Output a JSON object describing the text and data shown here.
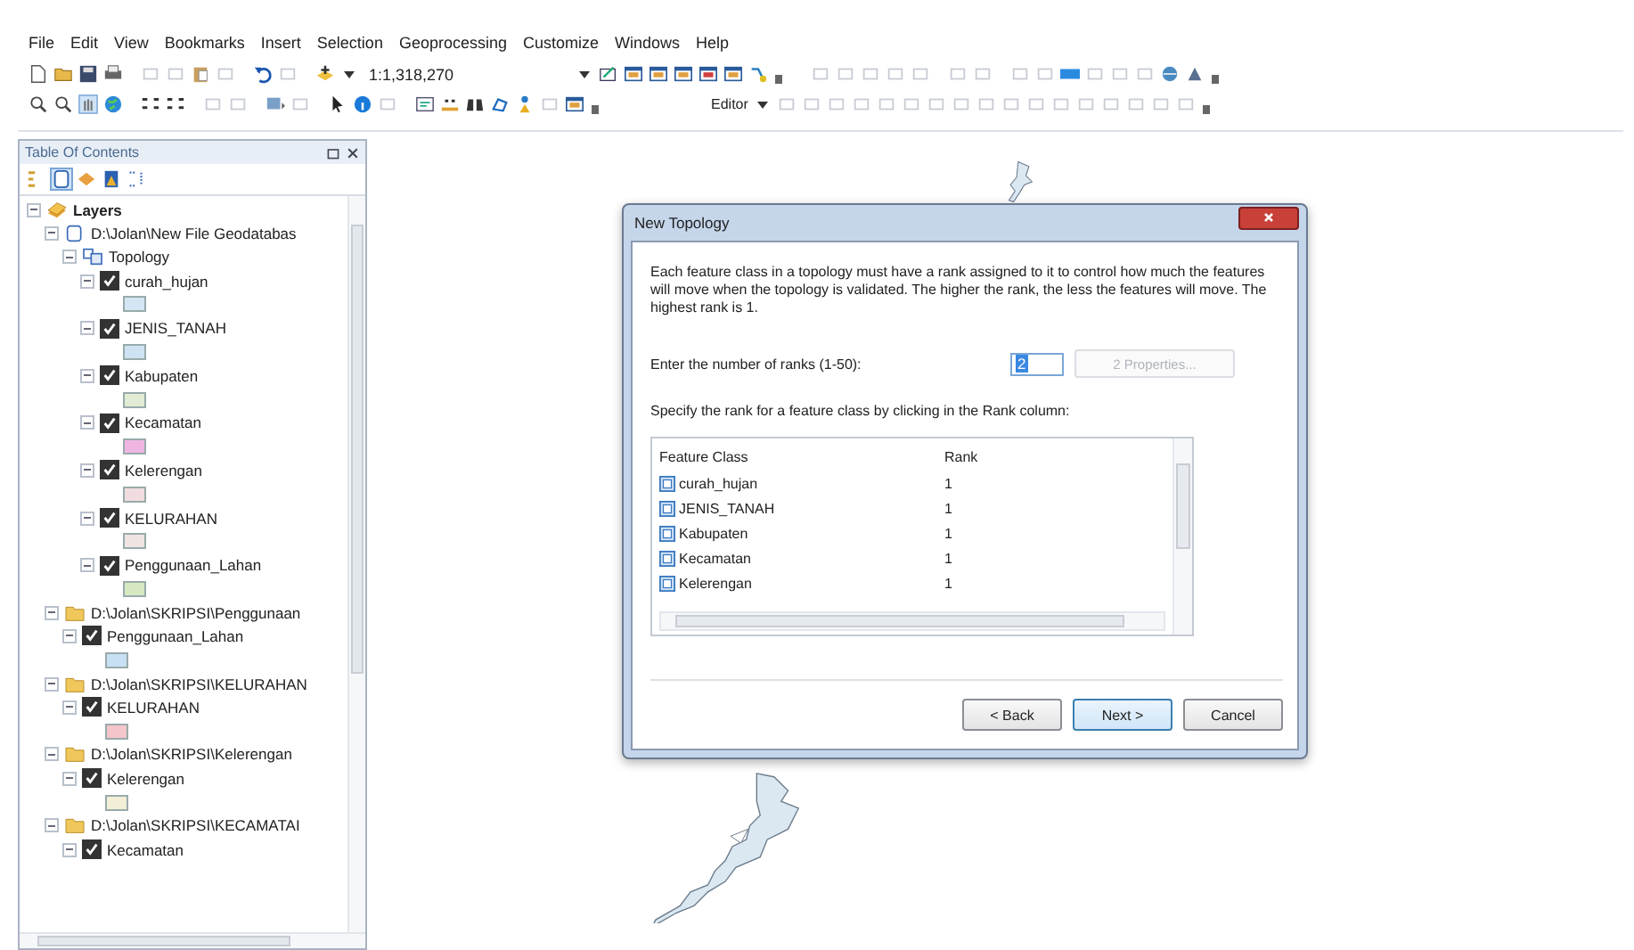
{
  "menu": [
    "File",
    "Edit",
    "View",
    "Bookmarks",
    "Insert",
    "Selection",
    "Geoprocessing",
    "Customize",
    "Windows",
    "Help"
  ],
  "toolbar": {
    "scale": "1:1,318,270",
    "editor": "Editor"
  },
  "toc": {
    "title": "Table Of Contents",
    "tree": [
      {
        "kind": "frame",
        "label": "Layers",
        "expanded": true,
        "children": [
          {
            "kind": "database",
            "label": "D:\\Jolan\\New File Geodatabas",
            "expanded": true,
            "children": [
              {
                "kind": "topology",
                "label": "Topology",
                "expanded": true,
                "children": [
                  {
                    "kind": "layer",
                    "label": "curah_hujan",
                    "checked": true,
                    "expanded": true,
                    "color": "#d4e6f4"
                  },
                  {
                    "kind": "layer",
                    "label": "JENIS_TANAH",
                    "checked": true,
                    "expanded": true,
                    "color": "#cfe2f2"
                  },
                  {
                    "kind": "layer",
                    "label": "Kabupaten",
                    "checked": true,
                    "expanded": true,
                    "color": "#e2ecd4"
                  },
                  {
                    "kind": "layer",
                    "label": "Kecamatan",
                    "checked": true,
                    "expanded": true,
                    "color": "#efb6e4"
                  },
                  {
                    "kind": "layer",
                    "label": "Kelerengan",
                    "checked": true,
                    "expanded": true,
                    "color": "#f1dcdf"
                  },
                  {
                    "kind": "layer",
                    "label": "KELURAHAN",
                    "checked": true,
                    "expanded": true,
                    "color": "#efe4e2"
                  },
                  {
                    "kind": "layer",
                    "label": "Penggunaan_Lahan",
                    "checked": true,
                    "expanded": true,
                    "color": "#d6e8c2"
                  }
                ]
              }
            ]
          },
          {
            "kind": "folder",
            "label": "D:\\Jolan\\SKRIPSI\\Penggunaan",
            "expanded": true,
            "children": [
              {
                "kind": "layer",
                "label": "Penggunaan_Lahan",
                "checked": true,
                "expanded": true,
                "color": "#c8e0f4"
              }
            ]
          },
          {
            "kind": "folder",
            "label": "D:\\Jolan\\SKRIPSI\\KELURAHAN",
            "expanded": true,
            "children": [
              {
                "kind": "layer",
                "label": "KELURAHAN",
                "checked": true,
                "expanded": true,
                "color": "#f4c6cb"
              }
            ]
          },
          {
            "kind": "folder",
            "label": "D:\\Jolan\\SKRIPSI\\Kelerengan",
            "expanded": true,
            "children": [
              {
                "kind": "layer",
                "label": "Kelerengan",
                "checked": true,
                "expanded": true,
                "color": "#f2efd6"
              }
            ]
          },
          {
            "kind": "folder",
            "label": "D:\\Jolan\\SKRIPSI\\KECAMATAI",
            "expanded": true,
            "children": [
              {
                "kind": "layer",
                "label": "Kecamatan",
                "checked": true,
                "expanded": true
              }
            ]
          }
        ]
      }
    ]
  },
  "dialog": {
    "title": "New Topology",
    "intro": "Each feature class in a topology must have a rank assigned to it to control how much the features will move when the topology is validated. The higher the rank, the less the features will move. The highest rank is 1.",
    "ranks_label": "Enter the number of ranks  (1-50):",
    "ranks_value": "2",
    "properties_button": {
      "label": "2 Properties...",
      "disabled": true
    },
    "specify_label": "Specify the rank for a feature class by clicking in the Rank column:",
    "columns": [
      "Feature Class",
      "Rank"
    ],
    "rows": [
      {
        "name": "curah_hujan",
        "rank": "1"
      },
      {
        "name": "JENIS_TANAH",
        "rank": "1"
      },
      {
        "name": "Kabupaten",
        "rank": "1"
      },
      {
        "name": "Kecamatan",
        "rank": "1"
      },
      {
        "name": "Kelerengan",
        "rank": "1"
      }
    ],
    "buttons": [
      {
        "label": "< Back",
        "default": false
      },
      {
        "label": "Next >",
        "default": true
      },
      {
        "label": "Cancel",
        "default": false
      }
    ]
  }
}
